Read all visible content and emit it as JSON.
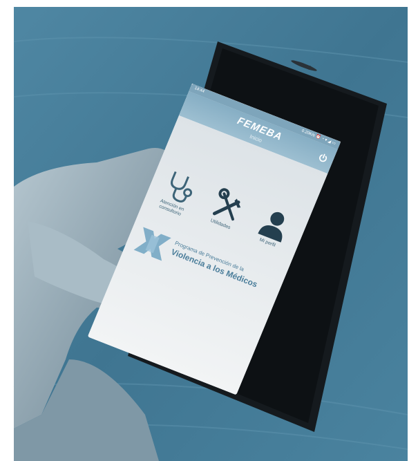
{
  "status": {
    "time": "14:44",
    "right": "0.20K/s ⏰ ◔ ▾ ◢ ▭"
  },
  "app": {
    "brand": "FEMEBA",
    "subtitle": "Inicio"
  },
  "menu": [
    {
      "label": "Atención en consultorio",
      "icon": "stethoscope-icon"
    },
    {
      "label": "Utilidades",
      "icon": "tools-icon"
    },
    {
      "label": "Mi perfil",
      "icon": "user-profile-icon"
    }
  ],
  "program": {
    "line1": "Programa de Prevención de la",
    "line2": "Violencia a los Médicos"
  },
  "colors": {
    "appbar": "#86aec4",
    "ink": "#3d6478",
    "bg_table": "#3d6f8a"
  }
}
